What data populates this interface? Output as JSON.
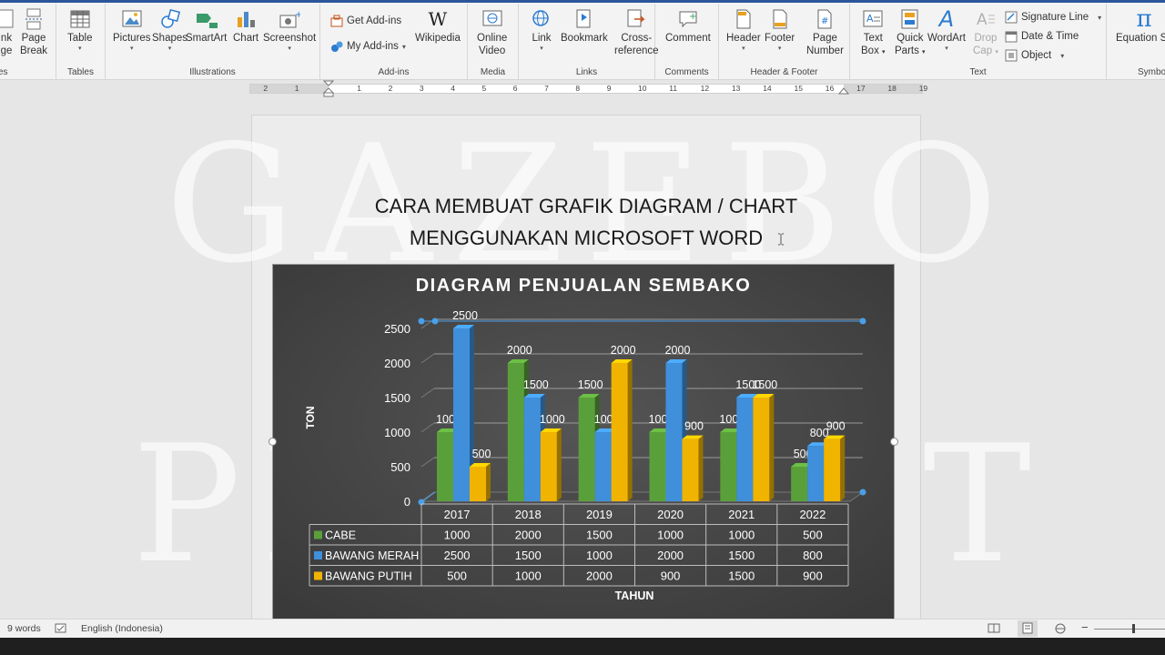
{
  "ribbon": {
    "pages_group": {
      "blank_page_top": "nk",
      "blank_page_bottom": "ge",
      "page_break_top": "Page",
      "page_break_bottom": "Break",
      "label": "es"
    },
    "tables_group": {
      "table": "Table",
      "label": "Tables"
    },
    "illustrations_group": {
      "pictures": "Pictures",
      "shapes": "Shapes",
      "smartart": "SmartArt",
      "chart": "Chart",
      "screenshot": "Screenshot",
      "label": "Illustrations"
    },
    "addins_group": {
      "get_addins": "Get Add-ins",
      "my_addins": "My Add-ins",
      "wikipedia": "Wikipedia",
      "label": "Add-ins"
    },
    "media_group": {
      "online_video_top": "Online",
      "online_video_bottom": "Video",
      "label": "Media"
    },
    "links_group": {
      "link": "Link",
      "bookmark": "Bookmark",
      "crossref_top": "Cross-",
      "crossref_bottom": "reference",
      "label": "Links"
    },
    "comments_group": {
      "comment": "Comment",
      "label": "Comments"
    },
    "header_footer_group": {
      "header": "Header",
      "footer": "Footer",
      "page_number_top": "Page",
      "page_number_bottom": "Number",
      "label": "Header & Footer"
    },
    "text_group": {
      "text_box_top": "Text",
      "text_box_bottom": "Box",
      "quick_parts_top": "Quick",
      "quick_parts_bottom": "Parts",
      "wordart": "WordArt",
      "drop_cap_top": "Drop",
      "drop_cap_bottom": "Cap",
      "signature_line": "Signature Line",
      "date_time": "Date & Time",
      "object": "Object",
      "label": "Text"
    },
    "symbols_group": {
      "equation": "Equation",
      "symbol_partial": "Sy",
      "label": "Symbo"
    }
  },
  "ruler": {
    "numbers": [
      "2",
      "1",
      "1",
      "2",
      "3",
      "4",
      "5",
      "6",
      "7",
      "8",
      "9",
      "10",
      "11",
      "12",
      "13",
      "14",
      "15",
      "16",
      "17",
      "18",
      "19"
    ]
  },
  "document": {
    "title_line1": "CARA MEMBUAT GRAFIK DIAGRAM / CHART",
    "title_line2": "MENGGUNAKAN MICROSOFT WORD",
    "watermark_line1": "GAZEBO",
    "watermark_line2": "PROJECT"
  },
  "chart_data": {
    "type": "bar",
    "title": "DIAGRAM PENJUALAN SEMBAKO",
    "xlabel": "TAHUN",
    "ylabel": "TON",
    "categories": [
      "2017",
      "2018",
      "2019",
      "2020",
      "2021",
      "2022"
    ],
    "ylim": [
      0,
      2500
    ],
    "yticks": [
      "0",
      "500",
      "1000",
      "1500",
      "2000",
      "2500"
    ],
    "series": [
      {
        "name": "CABE",
        "color": "#5aa03a",
        "values": [
          1000,
          2000,
          1500,
          1000,
          1000,
          500
        ]
      },
      {
        "name": "BAWANG MERAH",
        "color": "#3f8fdb",
        "values": [
          2500,
          1500,
          1000,
          2000,
          1500,
          800
        ]
      },
      {
        "name": "BAWANG PUTIH",
        "color": "#f0b400",
        "values": [
          500,
          1000,
          2000,
          900,
          1500,
          900
        ]
      }
    ],
    "data_table": true,
    "grid": true,
    "style": "3d-column",
    "background": "#3a3a3a"
  },
  "status": {
    "words": "9 words",
    "language": "English (Indonesia)"
  },
  "colors": {
    "ribbon_accent": "#2b579a",
    "chart_bg": "#3a3a3a"
  }
}
